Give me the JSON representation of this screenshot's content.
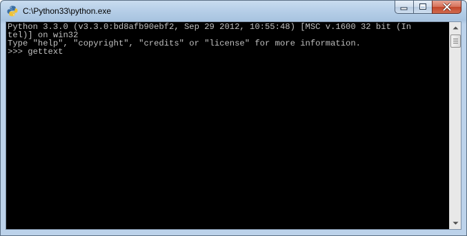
{
  "window": {
    "title": "C:\\Python33\\python.exe",
    "icon": "python-icon",
    "buttons": {
      "minimize": "minimize-icon",
      "maximize": "maximize-icon",
      "close": "close-icon"
    }
  },
  "console": {
    "lines": [
      "Python 3.3.0 (v3.3.0:bd8afb90ebf2, Sep 29 2012, 10:55:48) [MSC v.1600 32 bit (In",
      "tel)] on win32",
      "Type \"help\", \"copyright\", \"credits\" or \"license\" for more information.",
      ">>> gettext"
    ],
    "text_color": "#c0c0c0",
    "background_color": "#000000"
  },
  "scrollbar": {
    "up": "scroll-up-arrow-icon",
    "down": "scroll-down-arrow-icon"
  }
}
